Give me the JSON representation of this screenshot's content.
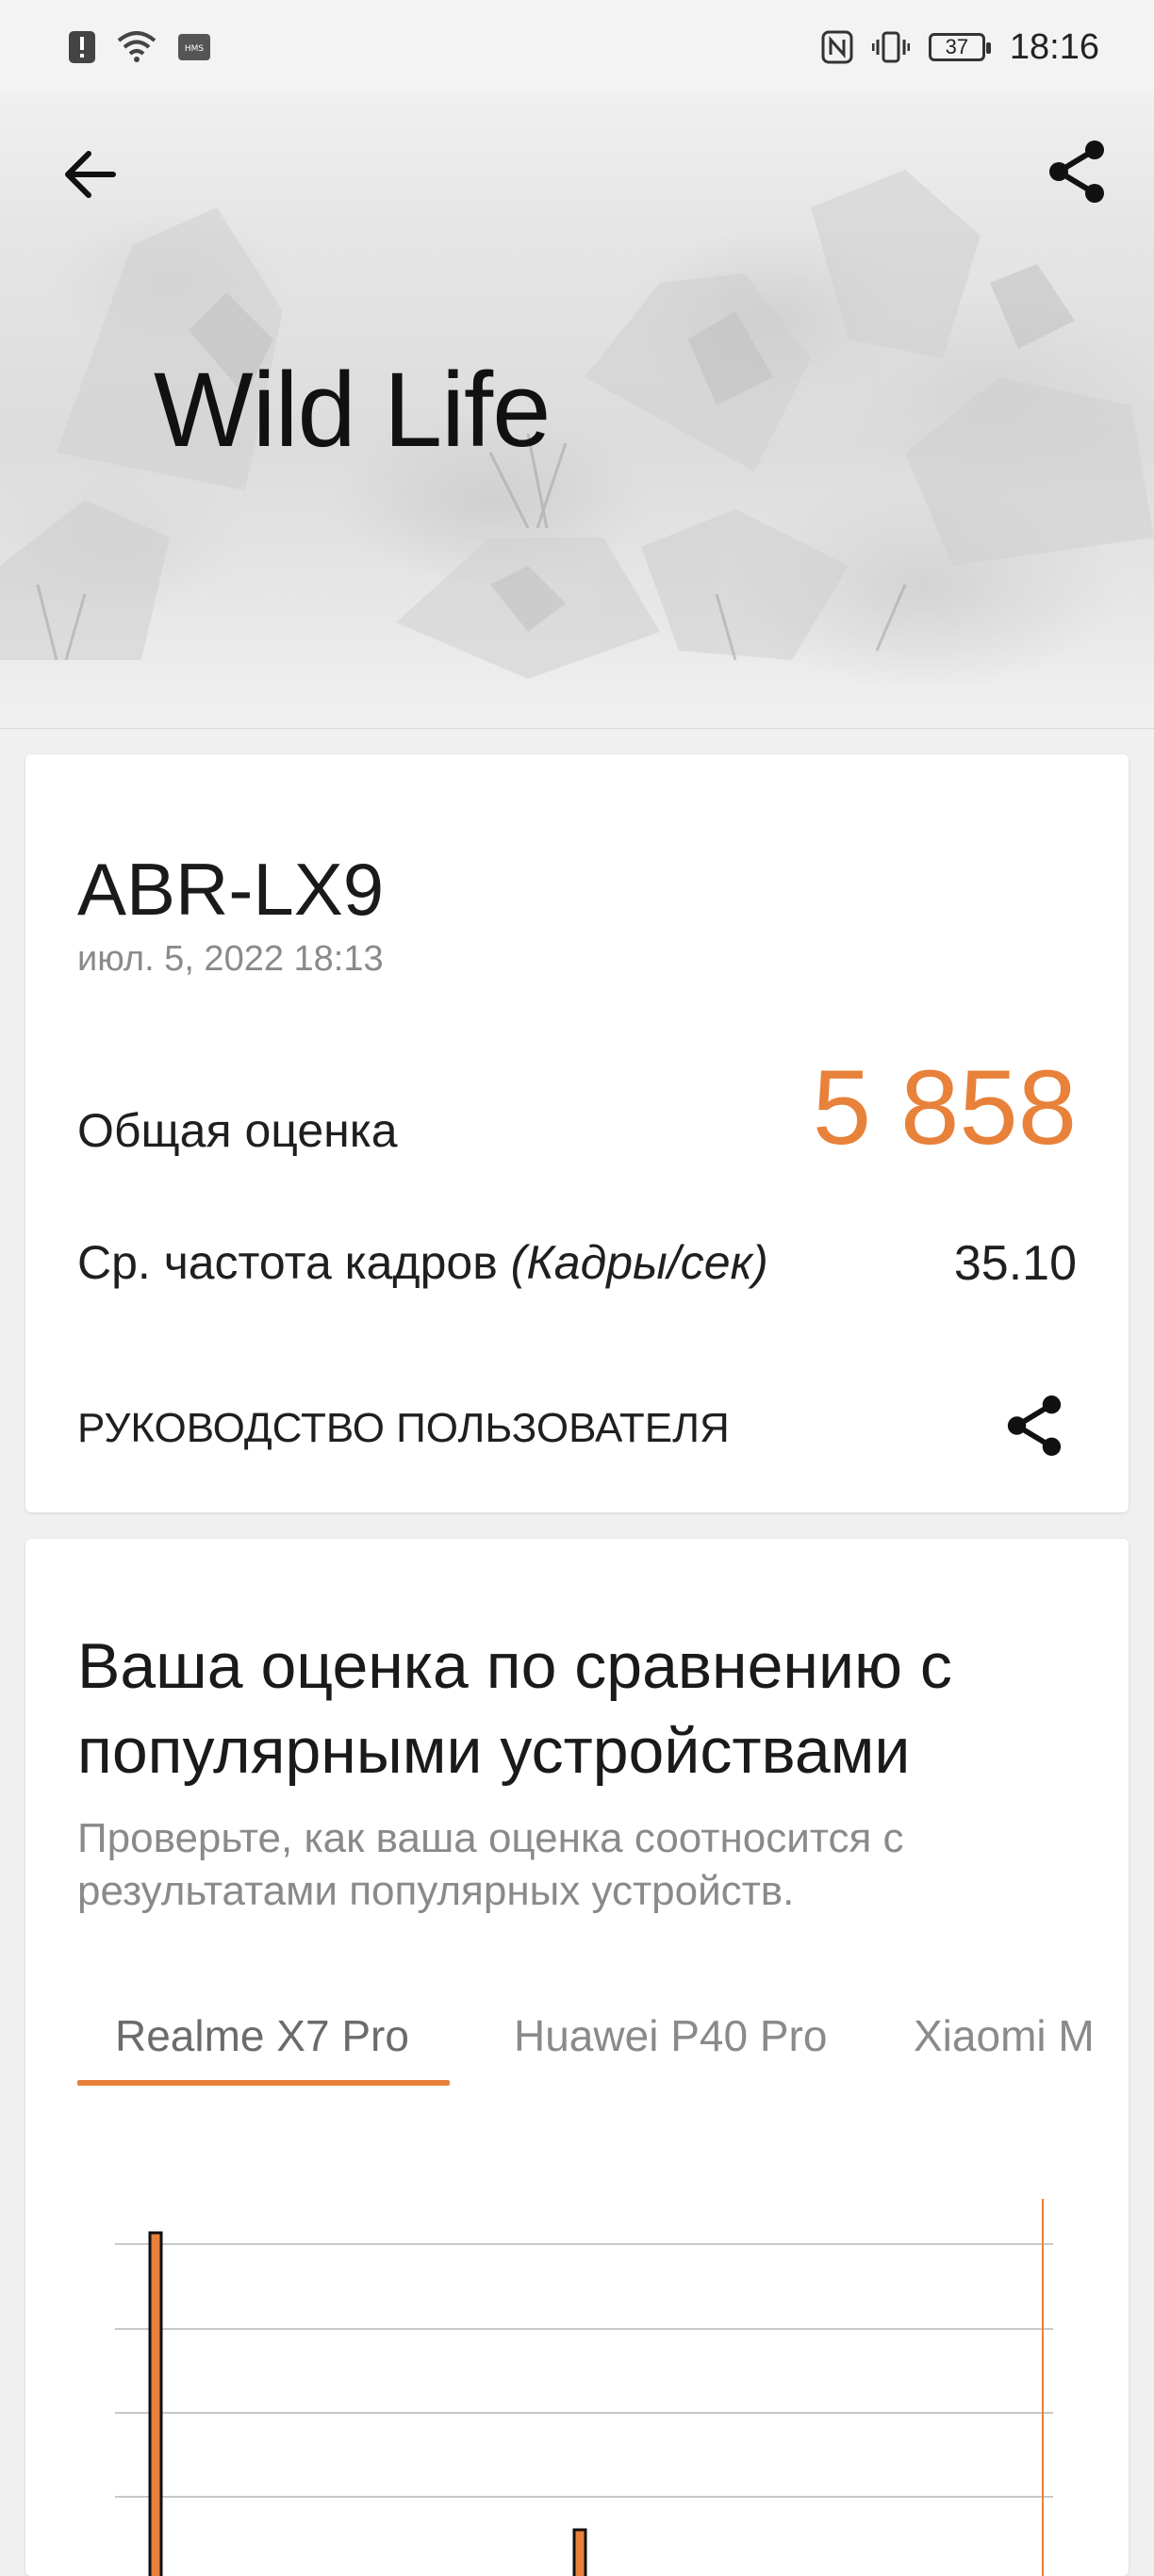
{
  "status_bar": {
    "time": "18:16",
    "battery": "37",
    "icons": [
      "alert-icon",
      "wifi-icon",
      "hms-icon",
      "nfc-icon",
      "vibrate-icon",
      "battery-icon"
    ]
  },
  "header": {
    "title": "Wild Life",
    "back_icon": "arrow-left-icon",
    "share_icon": "share-icon"
  },
  "result": {
    "device": "ABR-LX9",
    "datetime": "июл. 5, 2022 18:13",
    "score_label": "Общая оценка",
    "score_value": "5 858",
    "fps_label_prefix": "Ср. частота кадров ",
    "fps_label_unit": "(Кадры/сек)",
    "fps_value": "35.10",
    "guide_label": "РУКОВОДСТВО ПОЛЬЗОВАТЕЛЯ",
    "share_icon": "share-icon"
  },
  "comparison": {
    "title": "Ваша оценка по сравнению с популярными устройствами",
    "subtitle": "Проверьте, как ваша оценка соотносится с результатами популярных устройств.",
    "tabs": [
      {
        "label": "Realme X7 Pro",
        "selected": true
      },
      {
        "label": "Huawei P40 Pro",
        "selected": false
      },
      {
        "label": "Xiaomi M",
        "selected": false
      }
    ]
  },
  "colors": {
    "accent": "#e8813a",
    "background": "#f0f0f0",
    "card": "#ffffff",
    "text_secondary": "#8a8a8a"
  }
}
